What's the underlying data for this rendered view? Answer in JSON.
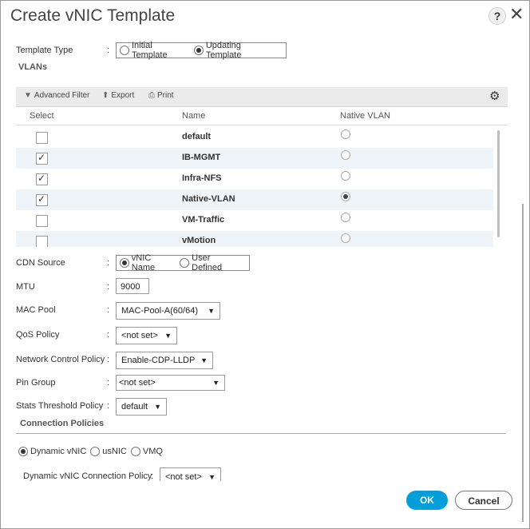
{
  "dialog": {
    "title": "Create vNIC Template",
    "help": "?",
    "close": "✕"
  },
  "template_type": {
    "label": "Template Type",
    "options": [
      {
        "label": "Initial Template",
        "selected": false
      },
      {
        "label": "Updating Template",
        "selected": true
      }
    ]
  },
  "vlans": {
    "section": "VLANs",
    "toolbar": {
      "filter": "Advanced Filter",
      "export": "Export",
      "print": "Print"
    },
    "columns": {
      "select": "Select",
      "name": "Name",
      "native": "Native VLAN"
    },
    "rows": [
      {
        "name": "default",
        "checked": false,
        "native": false
      },
      {
        "name": "IB-MGMT",
        "checked": true,
        "native": false
      },
      {
        "name": "Infra-NFS",
        "checked": true,
        "native": false
      },
      {
        "name": "Native-VLAN",
        "checked": true,
        "native": true
      },
      {
        "name": "VM-Traffic",
        "checked": false,
        "native": false
      },
      {
        "name": "vMotion",
        "checked": false,
        "native": false
      }
    ]
  },
  "cdn_source": {
    "label": "CDN Source",
    "options": [
      {
        "label": "vNIC Name",
        "selected": true
      },
      {
        "label": "User Defined",
        "selected": false
      }
    ]
  },
  "mtu": {
    "label": "MTU",
    "value": "9000"
  },
  "mac_pool": {
    "label": "MAC Pool",
    "value": "MAC-Pool-A(60/64)"
  },
  "qos_policy": {
    "label": "QoS Policy",
    "value": "<not set>"
  },
  "network_control_policy": {
    "label": "Network Control Policy",
    "value": "Enable-CDP-LLDP"
  },
  "pin_group": {
    "label": "Pin Group",
    "value": "<not set>"
  },
  "stats_threshold_policy": {
    "label": "Stats Threshold Policy",
    "value": "default"
  },
  "connection_policies": {
    "section": "Connection Policies",
    "options": [
      {
        "label": "Dynamic vNIC",
        "selected": true
      },
      {
        "label": "usNIC",
        "selected": false
      },
      {
        "label": "VMQ",
        "selected": false
      }
    ],
    "dynamic_policy": {
      "label": "Dynamic vNIC Connection Policy",
      "value": "<not set>"
    }
  },
  "buttons": {
    "ok": "OK",
    "cancel": "Cancel"
  },
  "colon": ":"
}
